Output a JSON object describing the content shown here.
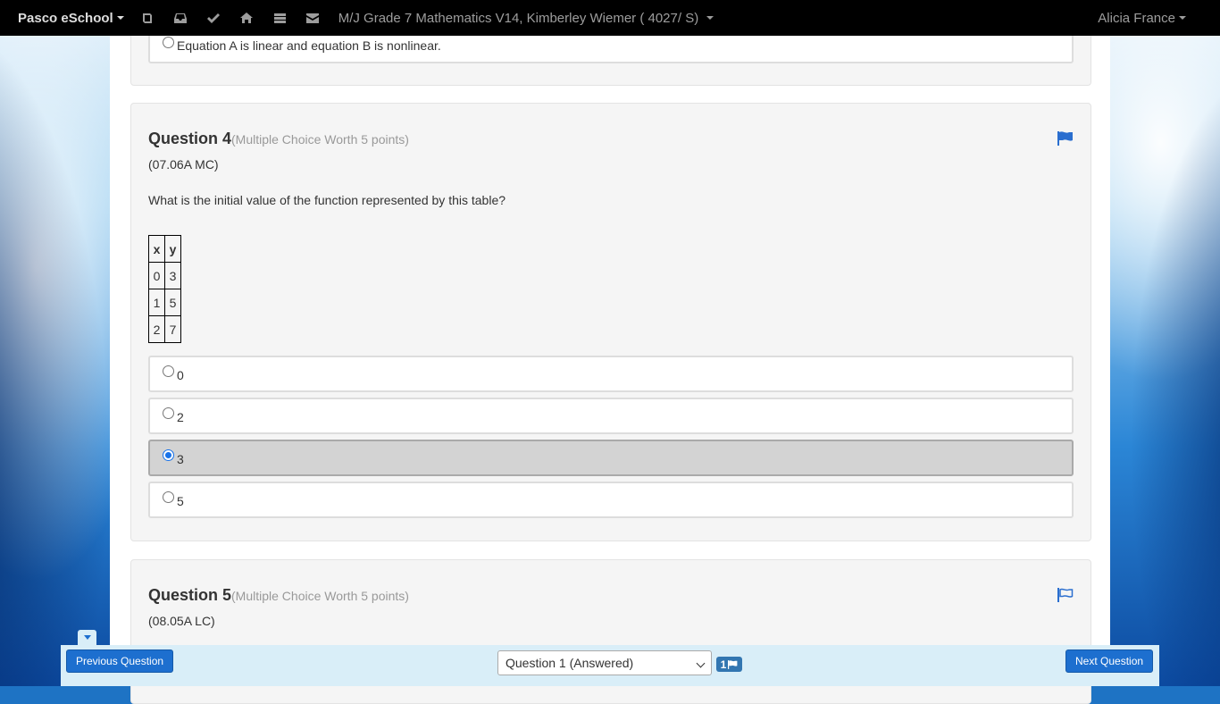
{
  "navbar": {
    "brand": "Pasco eSchool",
    "icons": [
      "book-icon",
      "inbox-icon",
      "check-icon",
      "home-icon",
      "list-icon",
      "envelope-icon"
    ],
    "course": "M/J Grade 7 Mathematics V14, Kimberley Wiemer ( 4027/ S)",
    "user": "Alicia France"
  },
  "question3": {
    "visible_choice": "Equation A is linear and equation B is nonlinear."
  },
  "question4": {
    "title": "Question 4",
    "meta": "(Multiple Choice Worth 5 points)",
    "code": "(07.06A MC)",
    "text": "What is the initial value of the function represented by this table?",
    "table": {
      "headers": [
        "x",
        "y"
      ],
      "rows": [
        [
          "0",
          "3"
        ],
        [
          "1",
          "5"
        ],
        [
          "2",
          "7"
        ]
      ]
    },
    "choices": [
      "0",
      "2",
      "3",
      "5"
    ],
    "selected": "3",
    "flagged": true
  },
  "question5": {
    "title": "Question 5",
    "meta": "(Multiple Choice Worth 5 points)",
    "code": "(08.05A LC)",
    "flagged": false
  },
  "bottom_bar": {
    "previous_label": "Previous Question",
    "next_label": "Next Question",
    "question_select": "Question 1 (Answered)",
    "flag_count": "1"
  },
  "colors": {
    "accent": "#1d6fcf",
    "navbar": "#000000",
    "panel": "#f5f5f5",
    "bottom_bar": "#d9eef8"
  }
}
